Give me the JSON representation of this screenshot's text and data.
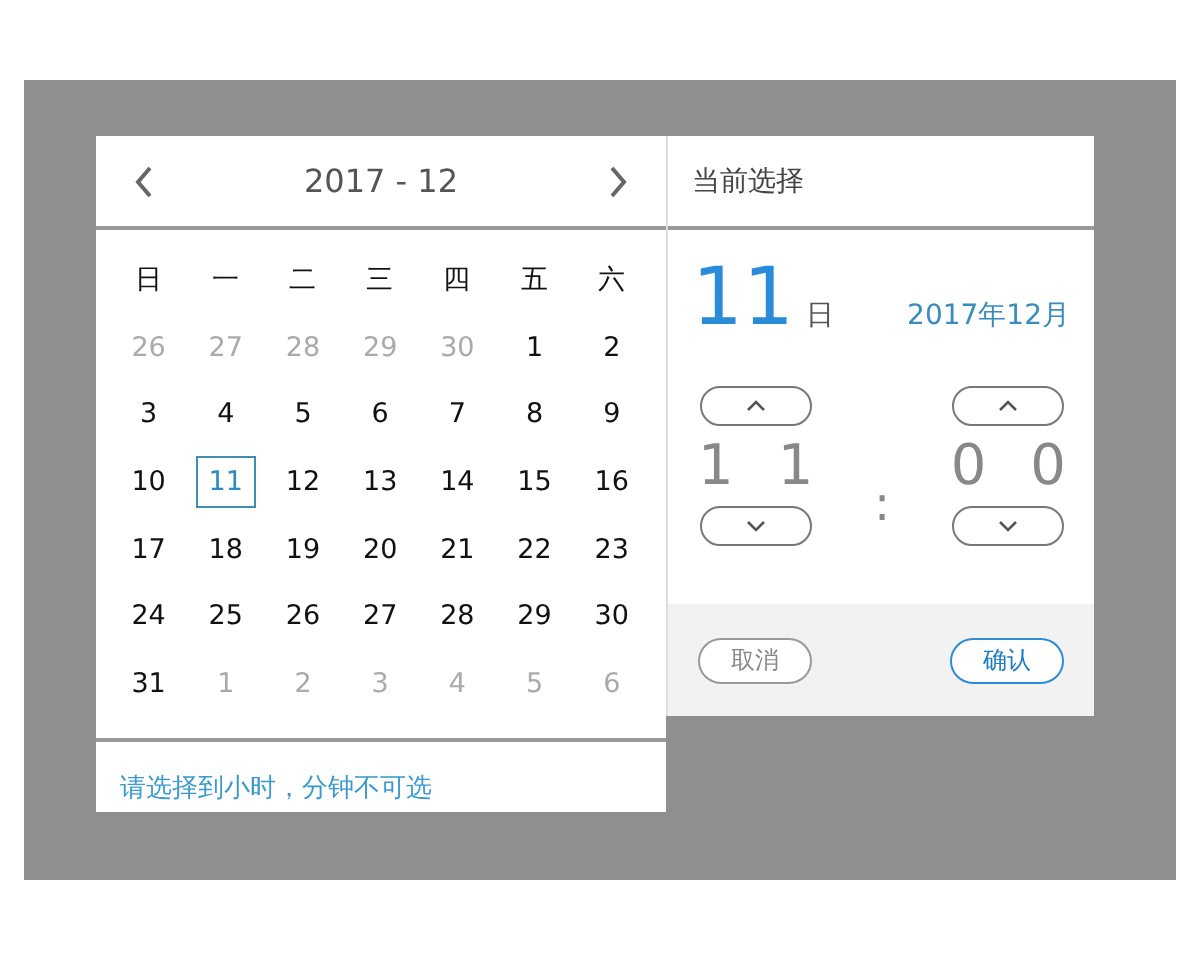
{
  "calendar": {
    "title": "2017 - 12",
    "weekdays": [
      "日",
      "一",
      "二",
      "三",
      "四",
      "五",
      "六"
    ],
    "days": [
      {
        "label": "26",
        "other_month": true,
        "selected": false
      },
      {
        "label": "27",
        "other_month": true,
        "selected": false
      },
      {
        "label": "28",
        "other_month": true,
        "selected": false
      },
      {
        "label": "29",
        "other_month": true,
        "selected": false
      },
      {
        "label": "30",
        "other_month": true,
        "selected": false
      },
      {
        "label": "1",
        "other_month": false,
        "selected": false
      },
      {
        "label": "2",
        "other_month": false,
        "selected": false
      },
      {
        "label": "3",
        "other_month": false,
        "selected": false
      },
      {
        "label": "4",
        "other_month": false,
        "selected": false
      },
      {
        "label": "5",
        "other_month": false,
        "selected": false
      },
      {
        "label": "6",
        "other_month": false,
        "selected": false
      },
      {
        "label": "7",
        "other_month": false,
        "selected": false
      },
      {
        "label": "8",
        "other_month": false,
        "selected": false
      },
      {
        "label": "9",
        "other_month": false,
        "selected": false
      },
      {
        "label": "10",
        "other_month": false,
        "selected": false
      },
      {
        "label": "11",
        "other_month": false,
        "selected": true
      },
      {
        "label": "12",
        "other_month": false,
        "selected": false
      },
      {
        "label": "13",
        "other_month": false,
        "selected": false
      },
      {
        "label": "14",
        "other_month": false,
        "selected": false
      },
      {
        "label": "15",
        "other_month": false,
        "selected": false
      },
      {
        "label": "16",
        "other_month": false,
        "selected": false
      },
      {
        "label": "17",
        "other_month": false,
        "selected": false
      },
      {
        "label": "18",
        "other_month": false,
        "selected": false
      },
      {
        "label": "19",
        "other_month": false,
        "selected": false
      },
      {
        "label": "20",
        "other_month": false,
        "selected": false
      },
      {
        "label": "21",
        "other_month": false,
        "selected": false
      },
      {
        "label": "22",
        "other_month": false,
        "selected": false
      },
      {
        "label": "23",
        "other_month": false,
        "selected": false
      },
      {
        "label": "24",
        "other_month": false,
        "selected": false
      },
      {
        "label": "25",
        "other_month": false,
        "selected": false
      },
      {
        "label": "26",
        "other_month": false,
        "selected": false
      },
      {
        "label": "27",
        "other_month": false,
        "selected": false
      },
      {
        "label": "28",
        "other_month": false,
        "selected": false
      },
      {
        "label": "29",
        "other_month": false,
        "selected": false
      },
      {
        "label": "30",
        "other_month": false,
        "selected": false
      },
      {
        "label": "31",
        "other_month": false,
        "selected": false
      },
      {
        "label": "1",
        "other_month": true,
        "selected": false
      },
      {
        "label": "2",
        "other_month": true,
        "selected": false
      },
      {
        "label": "3",
        "other_month": true,
        "selected": false
      },
      {
        "label": "4",
        "other_month": true,
        "selected": false
      },
      {
        "label": "5",
        "other_month": true,
        "selected": false
      },
      {
        "label": "6",
        "other_month": true,
        "selected": false
      }
    ],
    "note": "请选择到小时，分钟不可选"
  },
  "selection": {
    "title": "当前选择",
    "day": "11",
    "day_unit": "日",
    "year_month": "2017年12月",
    "hour": [
      "1",
      "1"
    ],
    "separator": ":",
    "minute": [
      "0",
      "0"
    ],
    "buttons": [
      {
        "kind": "cancel",
        "label": "取消"
      },
      {
        "kind": "confirm",
        "label": "确认"
      }
    ]
  }
}
